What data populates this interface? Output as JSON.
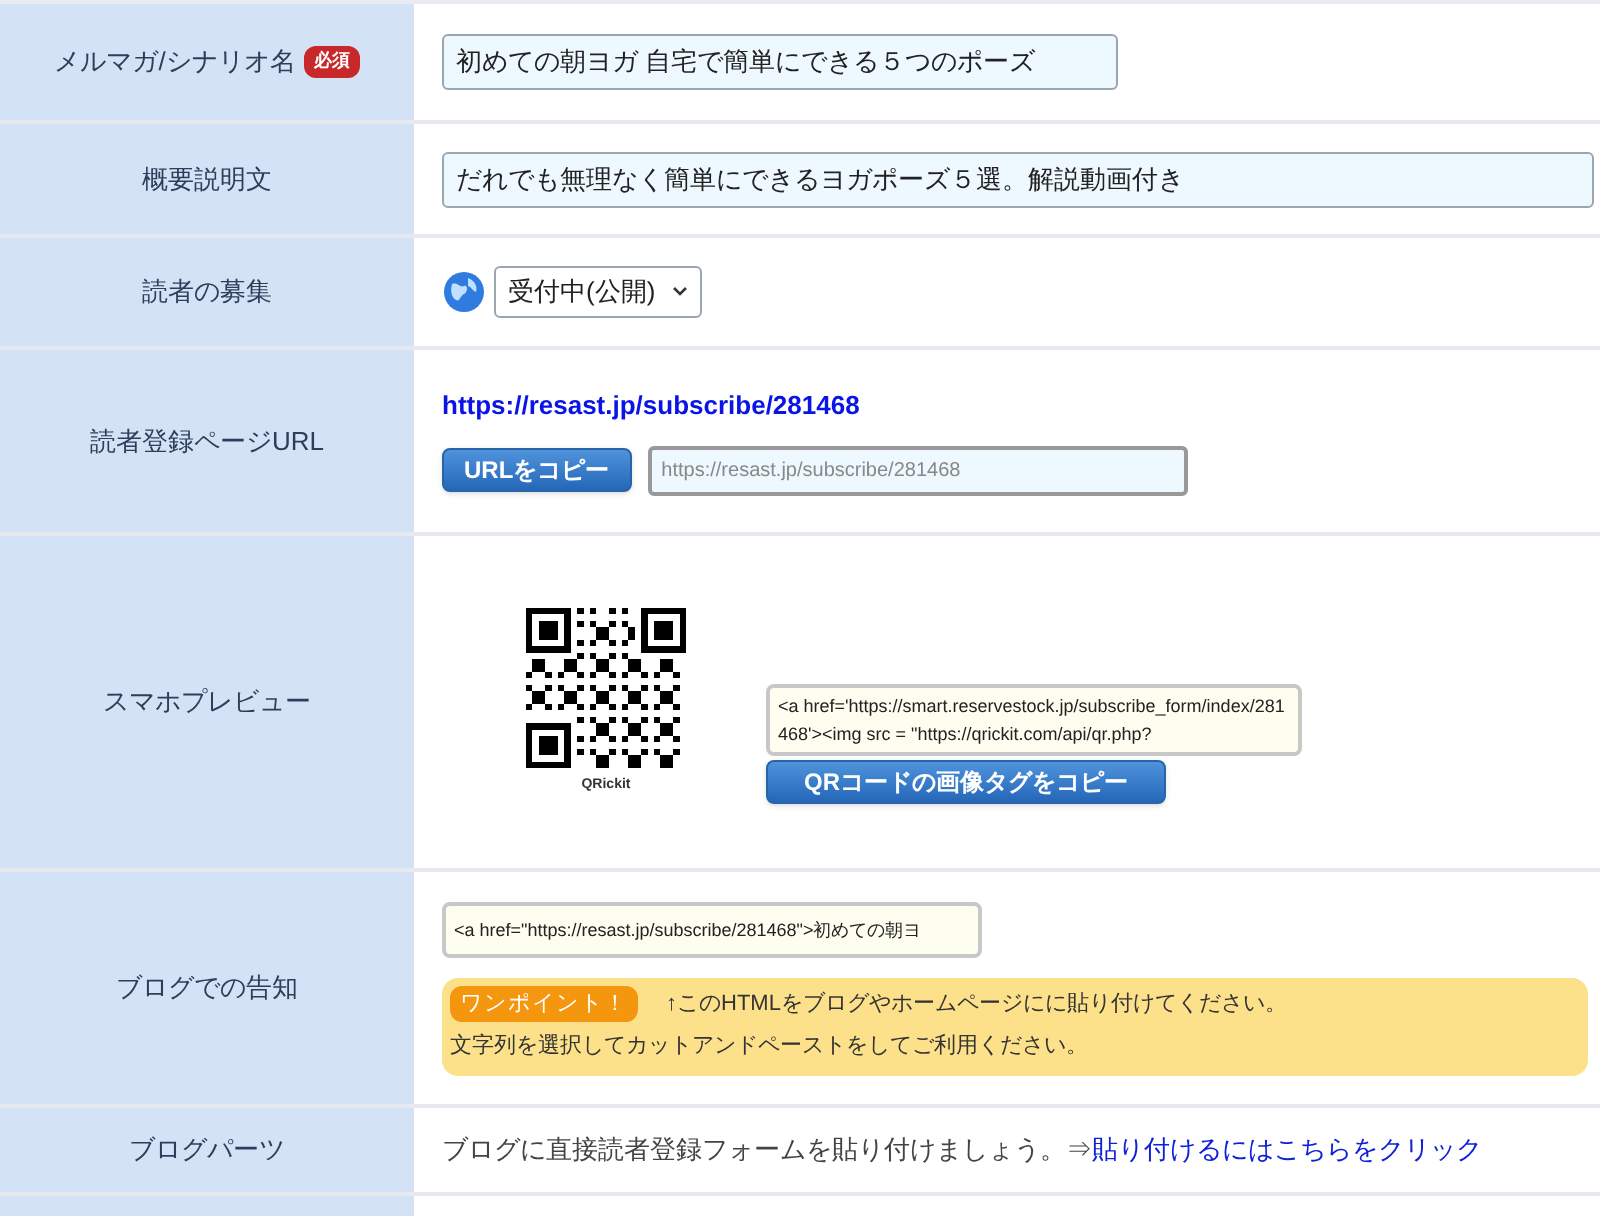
{
  "rows": [
    {
      "kind": "text_input",
      "label": "メルマガ/シナリオ名",
      "badge": "必須",
      "value": "初めての朝ヨガ 自宅で簡単にできる５つのポーズ"
    },
    {
      "kind": "wide_input",
      "label": "概要説明文",
      "value": "だれでも無理なく簡単にできるヨガポーズ５選。解説動画付き"
    },
    {
      "kind": "select",
      "label": "読者の募集",
      "value": "受付中(公開)"
    },
    {
      "kind": "url",
      "label": "読者登録ページURL",
      "link": "https://resast.jp/subscribe/281468",
      "button": "URLをコピー",
      "field_value": "https://resast.jp/subscribe/281468"
    },
    {
      "kind": "qr",
      "label": "スマホプレビュー",
      "caption": "QRickit",
      "code": "<a href='https://smart.reservestock.jp/subscribe_form/index/281468'><img src = \"https://qrickit.com/api/qr.php?",
      "button": "QRコードの画像タグをコピー"
    },
    {
      "kind": "blog",
      "label": "ブログでの告知",
      "code": "<a href=\"https://resast.jp/subscribe/281468\">初めての朝ヨ",
      "tip_badge": "ワンポイント！",
      "tip_line1": "↑このHTMLをブログやホームページにに貼り付けてください。",
      "tip_line2": "文字列を選択してカットアンドペーストをしてご利用ください。"
    },
    {
      "kind": "parts",
      "label": "ブログパーツ",
      "text": "ブログに直接読者登録フォームを貼り付けましょう。⇒",
      "link": "貼り付けるにはこちらをクリック"
    }
  ]
}
